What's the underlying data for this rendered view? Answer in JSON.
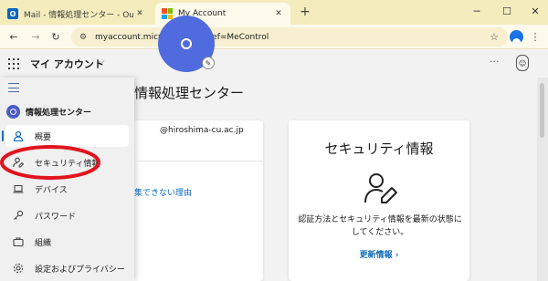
{
  "browser": {
    "tabs": [
      {
        "title": "Mail - 情報処理センター - Outlook",
        "icon": "outlook-icon",
        "active": false
      },
      {
        "title": "My Account",
        "icon": "microsoft-icon",
        "active": true
      }
    ],
    "url": "myaccount.microsoft.com/?ref=MeControl",
    "window_controls": {
      "minimize": "─",
      "maximize": "☐",
      "close": "✕"
    },
    "new_tab": "+"
  },
  "header": {
    "app_title": "マイ アカウント"
  },
  "sidebar": {
    "org_name": "情報処理センター",
    "items": [
      {
        "label": "概要",
        "icon": "person-icon",
        "selected": true
      },
      {
        "label": "セキュリティ情報",
        "icon": "person-key-icon",
        "selected": false
      },
      {
        "label": "デバイス",
        "icon": "laptop-icon",
        "selected": false
      },
      {
        "label": "パスワード",
        "icon": "key-icon",
        "selected": false
      },
      {
        "label": "組織",
        "icon": "briefcase-icon",
        "selected": false
      },
      {
        "label": "設定およびプライバシー",
        "icon": "gear-icon",
        "selected": false
      }
    ]
  },
  "profile_card": {
    "name": "情報処理センター",
    "email": "@hiroshima-cu.ac.jp",
    "link_partial": "集できない理由"
  },
  "security_card": {
    "title": "セキュリティ情報",
    "description": "認証方法とセキュリティ情報を最新の状態にしてください。",
    "link": "更新情報"
  },
  "colors": {
    "tabstrip": "#f5ecbd",
    "accent": "#0f6cbd",
    "avatar": "#4f6bdd",
    "annotation": "#e0141e"
  }
}
